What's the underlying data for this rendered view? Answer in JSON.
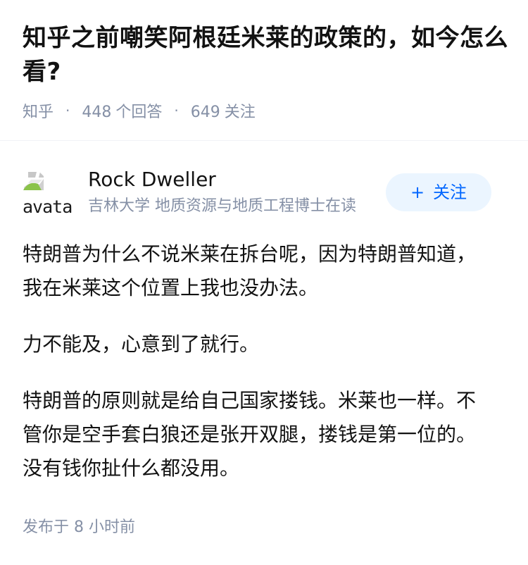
{
  "question": {
    "title": "知乎之前嘲笑阿根廷米莱的政策的，如今怎么看?",
    "meta": {
      "source": "知乎",
      "answer_count": "448",
      "answer_label": "个回答",
      "follower_count": "649",
      "follower_label": "关注"
    }
  },
  "answer": {
    "author": {
      "avatar_alt": "avatar",
      "name": "Rock Dweller",
      "bio": "吉林大学 地质资源与地质工程博士在读"
    },
    "follow_button": {
      "icon": "+",
      "label": "关注"
    },
    "paragraphs": [
      "特朗普为什么不说米莱在拆台呢，因为特朗普知道，我在米莱这个位置上我也没办法。",
      "力不能及，心意到了就行。",
      "特朗普的原则就是给自己国家搂钱。米莱也一样。不管你是空手套白狼还是张开双腿，搂钱是第一位的。没有钱你扯什么都没用。"
    ],
    "publish_time": "发布于 8 小时前"
  },
  "colors": {
    "title": "#121212",
    "meta": "#8590a6",
    "follow_bg": "#ebf5ff",
    "follow_text": "#0066ff",
    "divider": "#f0f2f7"
  }
}
